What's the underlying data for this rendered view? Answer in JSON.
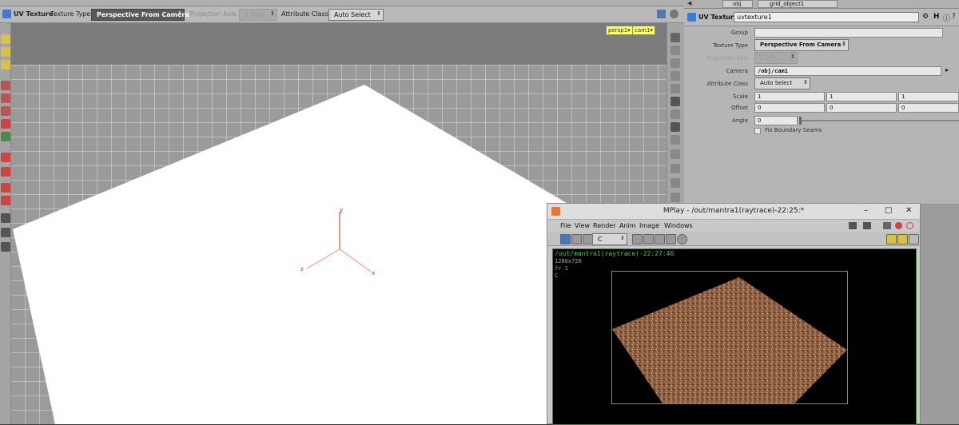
{
  "viewer_toolbar": {
    "node_label": "UV Texture",
    "texture_type_label": "Texture Type",
    "texture_type_value": "Perspective From Camera",
    "projection_axis_label": "Projection Axis",
    "projection_axis_value": "Z Axis",
    "attribute_class_label": "Attribute Class",
    "attribute_class_value": "Auto Select"
  },
  "viewport": {
    "camera_menu": "persp1",
    "cam_menu": "cam1",
    "axis_labels": {
      "y": "y",
      "x": "x",
      "z": "z"
    }
  },
  "param_header": {
    "path": "obj",
    "node": "grid_object1"
  },
  "params": {
    "node_type": "UV Texture",
    "node_name": "uvtexture1",
    "group_label": "Group",
    "group_value": "",
    "texture_type_label": "Texture Type",
    "texture_type_value": "Perspective From Camera",
    "projection_axis_label": "Projection Axis",
    "projection_axis_value": "Z Axis",
    "camera_label": "Camera",
    "camera_value": "/obj/cam1",
    "attribute_class_label": "Attribute Class",
    "attribute_class_value": "Auto Select",
    "scale_label": "Scale",
    "scale_values": [
      "1",
      "1",
      "1"
    ],
    "offset_label": "Offset",
    "offset_values": [
      "0",
      "0",
      "0"
    ],
    "angle_label": "Angle",
    "angle_value": "0",
    "fix_seams_label": "Fix Boundary Seams"
  },
  "mplay": {
    "title": "MPlay - /out/mantra1(raytrace)-22:25:*",
    "menus": [
      "File",
      "View",
      "Render",
      "Anim",
      "Image",
      "Windows"
    ],
    "channel_value": "C",
    "overlay_line1": "/out/mantra1(raytrace)-22:27:46",
    "overlay_line2": "1280x720",
    "overlay_line3": "fr 1",
    "overlay_line4": "C"
  }
}
